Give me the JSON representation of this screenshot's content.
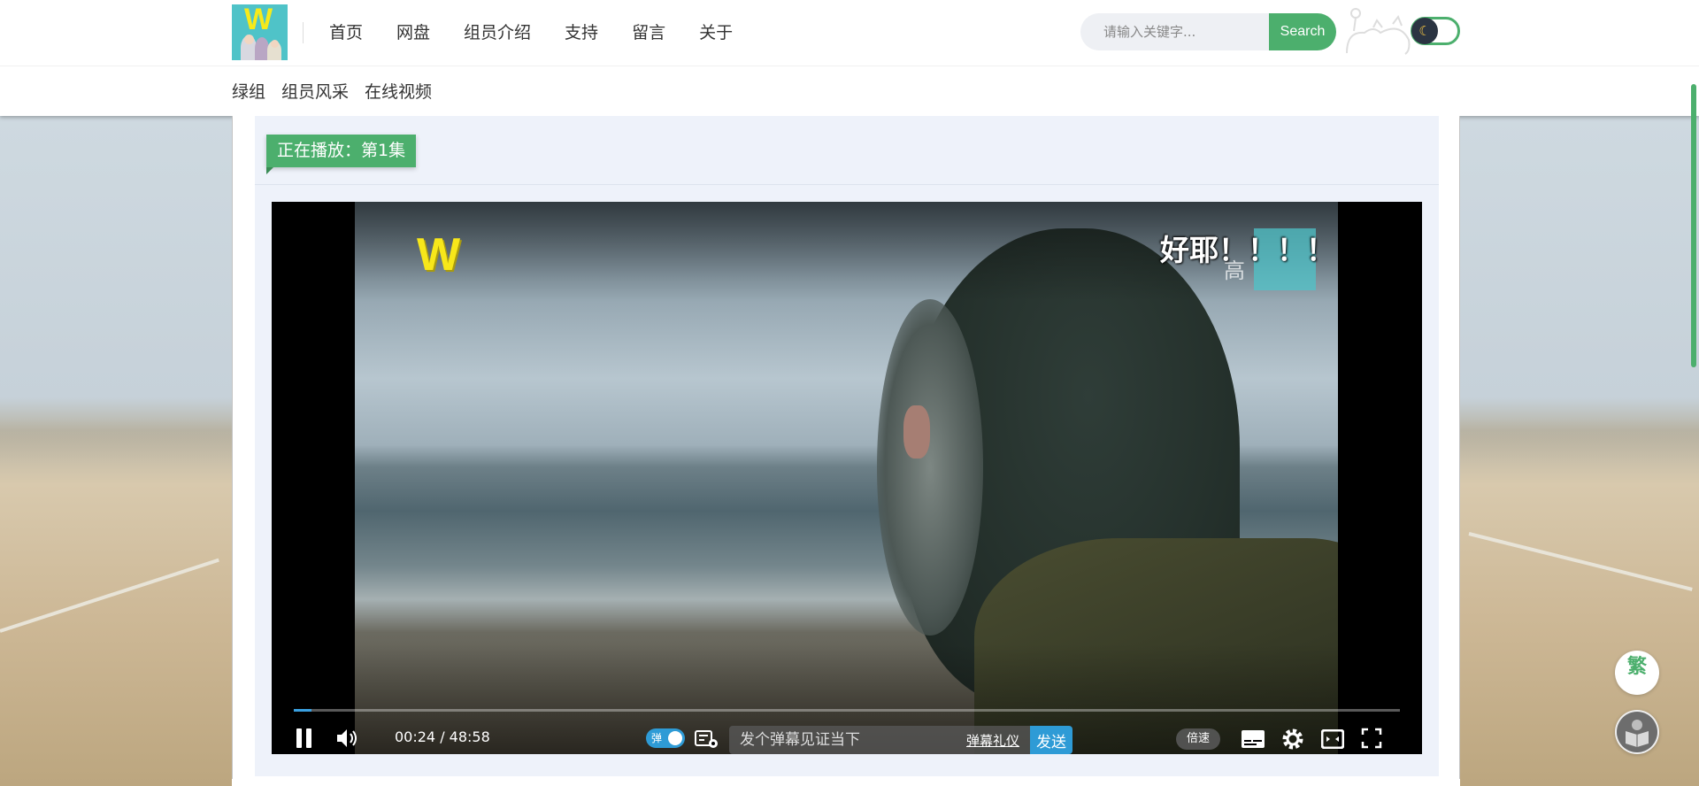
{
  "colors": {
    "accent": "#4caf6d",
    "danmaku_blue": "#2e9bd6",
    "panel_bg": "#eef2fa"
  },
  "header": {
    "logo_letter": "W",
    "nav": [
      "首页",
      "网盘",
      "组员介绍",
      "支持",
      "留言",
      "关于"
    ],
    "search": {
      "placeholder": "请输入关键字...",
      "button": "Search"
    },
    "theme_toggle_icon": "moon-icon"
  },
  "subnav": [
    "绿组",
    "组员风采",
    "在线视频"
  ],
  "player": {
    "now_playing": "正在播放：第1集",
    "overlay": {
      "logo_letter": "W",
      "danmaku_text": "好耶！！！！",
      "faint_text": "高"
    },
    "progress": 0.008,
    "time": "00:24 / 48:58",
    "danmaku_toggle_label": "弹",
    "danmaku_input_placeholder": "发个弹幕见证当下",
    "danmaku_etiquette": "弹幕礼仪",
    "send": "发送",
    "speed": "倍速"
  },
  "float_buttons": {
    "traditional": "繁",
    "reader_icon": "book-icon"
  }
}
